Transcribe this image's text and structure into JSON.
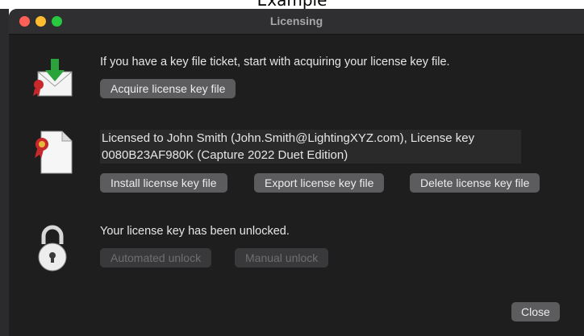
{
  "caption": "Example",
  "window": {
    "title": "Licensing"
  },
  "acquire": {
    "text": "If you have a key file ticket, start with acquiring your license key file.",
    "button": "Acquire license key file"
  },
  "license": {
    "line1": "Licensed to John Smith (John.Smith@LightingXYZ.com), License key",
    "line2": "0080B23AF980K (Capture 2022 Duet Edition)",
    "install_button": "Install license key file",
    "export_button": "Export license key file",
    "delete_button": "Delete license key file"
  },
  "unlock": {
    "text": "Your license key has been unlocked.",
    "automated_button": "Automated unlock",
    "manual_button": "Manual unlock"
  },
  "footer": {
    "close_button": "Close"
  },
  "colors": {
    "close": "#fe5f57",
    "minimize": "#febc2e",
    "maximize": "#28c840",
    "button": "#5c5b5e",
    "window": "#1e1e1f"
  }
}
